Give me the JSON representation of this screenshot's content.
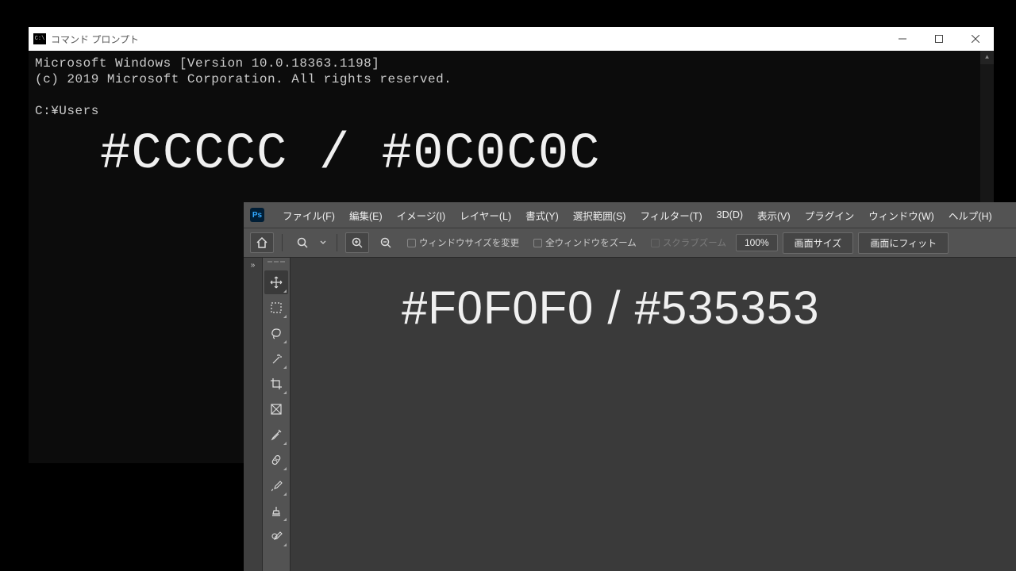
{
  "cmd": {
    "title": "コマンド プロンプト",
    "line1": "Microsoft Windows [Version 10.0.18363.1198]",
    "line2": "(c) 2019 Microsoft Corporation. All rights reserved.",
    "prompt": "C:¥Users",
    "overlay": "#CCCCC / #0C0C0C"
  },
  "ps": {
    "logo": "Ps",
    "menu": {
      "file": "ファイル(F)",
      "edit": "編集(E)",
      "image": "イメージ(I)",
      "layer": "レイヤー(L)",
      "type": "書式(Y)",
      "select": "選択範囲(S)",
      "filter": "フィルター(T)",
      "3d": "3D(D)",
      "view": "表示(V)",
      "plugins": "プラグイン",
      "window": "ウィンドウ(W)",
      "help": "ヘルプ(H)"
    },
    "options": {
      "resize_windows": "ウィンドウサイズを変更",
      "zoom_all": "全ウィンドウをズーム",
      "scrubby": "スクラブズーム",
      "zoom_value": "100%",
      "screen_size": "画面サイズ",
      "fit_screen": "画面にフィット"
    },
    "overlay": "#F0F0F0 / #535353"
  }
}
